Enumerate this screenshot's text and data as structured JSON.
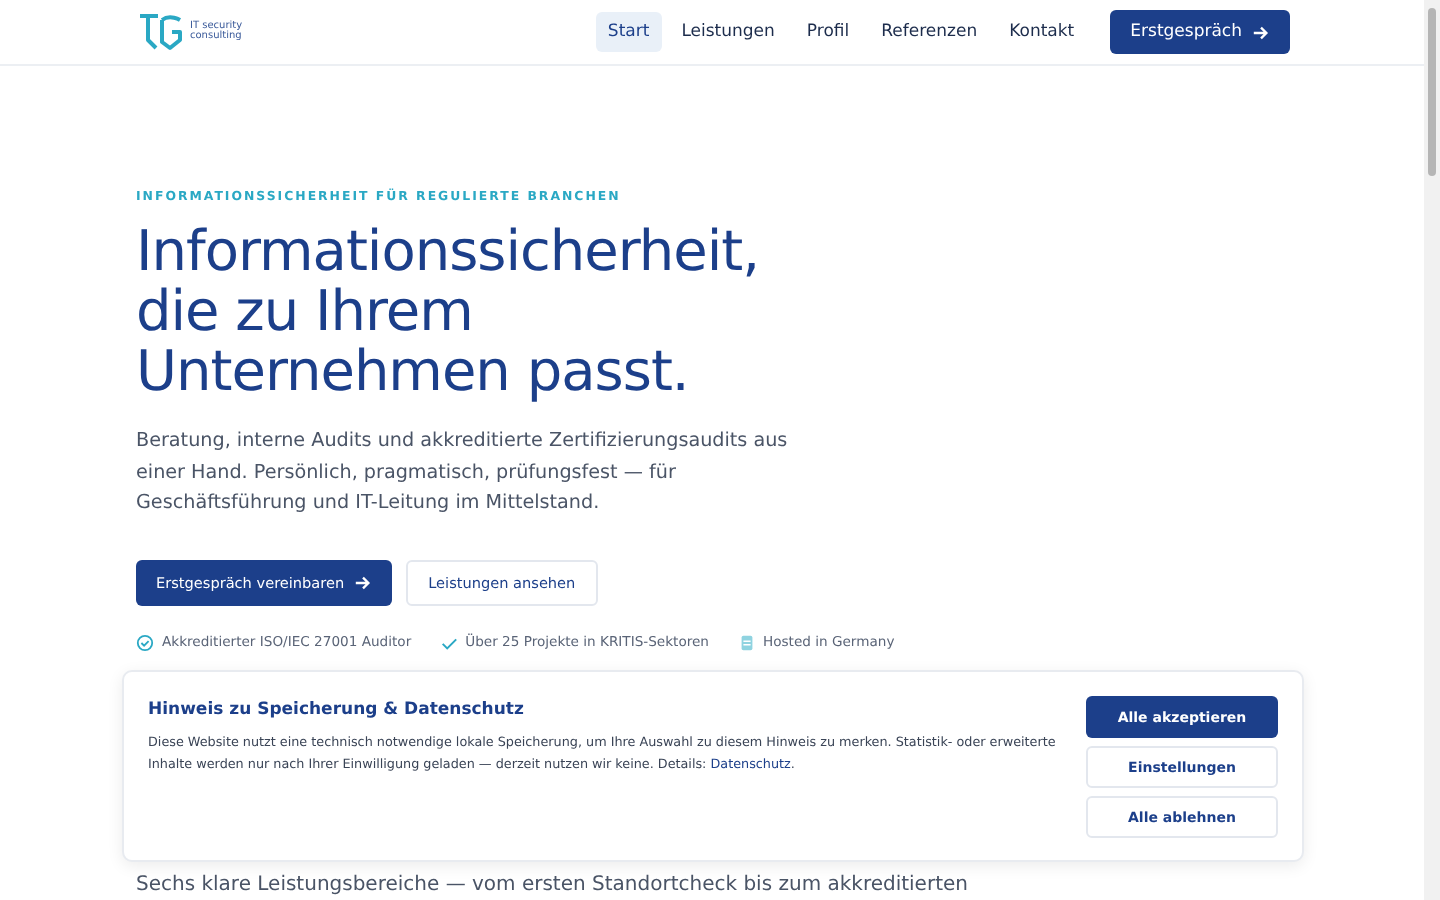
{
  "header": {
    "logo_text": "IT security consulting",
    "nav": [
      {
        "label": "Start",
        "selected": true
      },
      {
        "label": "Leistungen",
        "selected": false
      },
      {
        "label": "Profil",
        "selected": false
      },
      {
        "label": "Referenzen",
        "selected": false
      },
      {
        "label": "Kontakt",
        "selected": false
      }
    ],
    "cta": "Erstgespräch"
  },
  "hero": {
    "eyebrow": "INFORMATIONSSICHERHEIT FÜR REGULIERTE BRANCHEN",
    "title_lines": [
      "Informationssicherheit,",
      "die zu Ihrem",
      "Unternehmen passt."
    ],
    "lead": "Beratung, interne Audits und akkreditierte Zertifizierungsaudits aus einer Hand. Persönlich, pragmatisch, prüfungsfest — für Geschäftsführung und IT-Leitung im Mittelstand.",
    "primary_button": "Erstgespräch vereinbaren",
    "secondary_button": "Leistungen ansehen",
    "trust": [
      {
        "kind": "badge",
        "text": "Akkreditierter ISO/IEC 27001 Auditor"
      },
      {
        "kind": "check",
        "text": "Über 25 Projekte in KRITIS-Sektoren"
      },
      {
        "kind": "server",
        "text": "Hosted in Germany"
      }
    ]
  },
  "section_intro": "Sechs klare Leistungsbereiche — vom ersten Standortcheck bis zum akkreditierten",
  "cookie_banner": {
    "title": "Hinweis zu Speicherung & Datenschutz",
    "text": "Diese Website nutzt eine technisch notwendige lokale Speicherung, um Ihre Auswahl zu diesem Hinweis zu merken. Statistik- oder erweiterte Inhalte werden nur nach Ihrer Einwilligung geladen — derzeit nutzen wir keine. Details:",
    "link": "Datenschutz",
    "after_link": ".",
    "buttons": [
      {
        "label": "Alle akzeptieren",
        "kind": "primary"
      },
      {
        "label": "Einstellungen",
        "kind": "secondary"
      },
      {
        "label": "Alle ablehnen",
        "kind": "secondary"
      }
    ]
  }
}
